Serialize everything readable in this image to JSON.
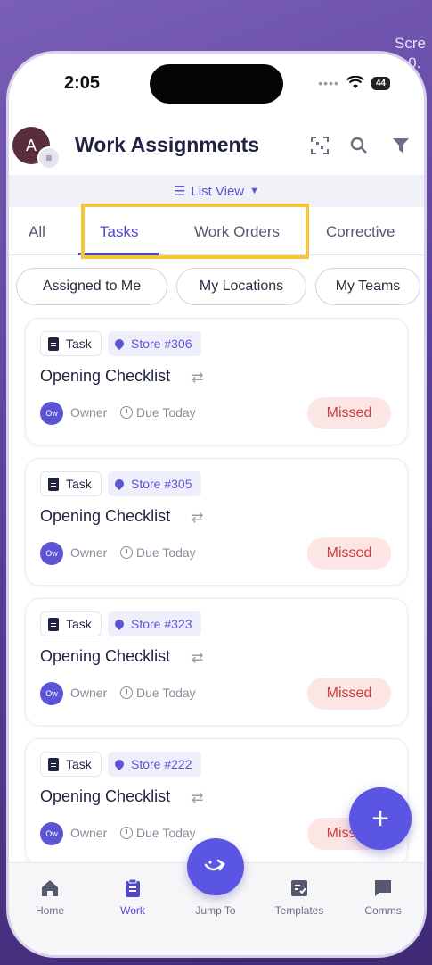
{
  "background": {
    "text": "Scre\n3-0."
  },
  "status_bar": {
    "time": "2:05",
    "battery": "44"
  },
  "header": {
    "avatar_initial": "A",
    "title": "Work Assignments"
  },
  "view_toggle": {
    "label": "List View"
  },
  "tabs": [
    {
      "label": "All"
    },
    {
      "label": "Tasks"
    },
    {
      "label": "Work Orders"
    },
    {
      "label": "Corrective"
    }
  ],
  "filters": [
    {
      "label": "Assigned to Me"
    },
    {
      "label": "My Locations"
    },
    {
      "label": "My Teams"
    }
  ],
  "cards": [
    {
      "type": "Task",
      "location": "Store #306",
      "title": "Opening Checklist",
      "owner_initials": "Ow",
      "owner": "Owner",
      "due": "Due Today",
      "status": "Missed"
    },
    {
      "type": "Task",
      "location": "Store #305",
      "title": "Opening Checklist",
      "owner_initials": "Ow",
      "owner": "Owner",
      "due": "Due Today",
      "status": "Missed"
    },
    {
      "type": "Task",
      "location": "Store #323",
      "title": "Opening Checklist",
      "owner_initials": "Ow",
      "owner": "Owner",
      "due": "Due Today",
      "status": "Missed"
    },
    {
      "type": "Task",
      "location": "Store #222",
      "title": "Opening Checklist",
      "owner_initials": "Ow",
      "owner": "Owner",
      "due": "Due Today",
      "status": "Missed"
    }
  ],
  "fab": {
    "symbol": "+"
  },
  "bottom_nav": [
    {
      "label": "Home"
    },
    {
      "label": "Work"
    },
    {
      "label": "Jump To"
    },
    {
      "label": "Templates"
    },
    {
      "label": "Comms"
    }
  ],
  "colors": {
    "accent": "#4f49c9",
    "highlight_box": "#f3c73b",
    "missed_bg": "#fce5e5",
    "missed_text": "#d23c3c"
  }
}
